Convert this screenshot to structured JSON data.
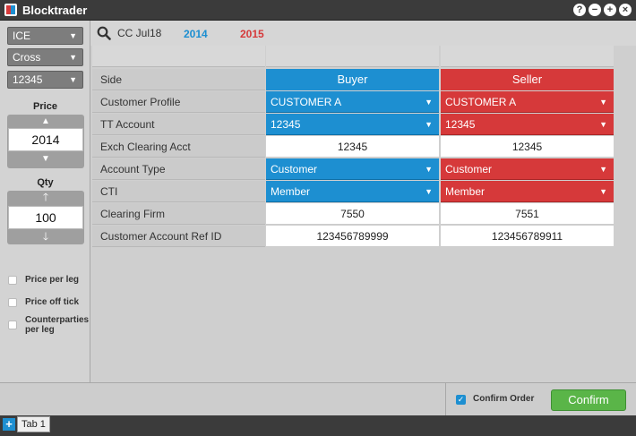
{
  "app": {
    "title": "Blocktrader"
  },
  "window_controls": [
    "help-icon",
    "minimize-icon",
    "add-icon",
    "close-icon"
  ],
  "left_panel": {
    "dropdowns": [
      {
        "value": "ICE"
      },
      {
        "value": "Cross"
      },
      {
        "value": "12345"
      }
    ],
    "price": {
      "label": "Price",
      "value": "2014"
    },
    "qty": {
      "label": "Qty",
      "value": "100"
    },
    "options": [
      {
        "label": "Price per leg",
        "checked": false
      },
      {
        "label": "Price off tick",
        "checked": false
      },
      {
        "label": "Counterparties per leg",
        "checked": false
      }
    ]
  },
  "header": {
    "contract": "CC Jul18",
    "year1": "2014",
    "year2": "2015"
  },
  "grid": {
    "rows": [
      {
        "label": "Side",
        "buyer": "Buyer",
        "seller": "Seller",
        "kind": "header"
      },
      {
        "label": "Customer Profile",
        "buyer": "CUSTOMER A",
        "seller": "CUSTOMER A",
        "kind": "select"
      },
      {
        "label": "TT Account",
        "buyer": "12345",
        "seller": "12345",
        "kind": "select"
      },
      {
        "label": "Exch Clearing Acct",
        "buyer": "12345",
        "seller": "12345",
        "kind": "text"
      },
      {
        "label": "Account Type",
        "buyer": "Customer",
        "seller": "Customer",
        "kind": "select"
      },
      {
        "label": "CTI",
        "buyer": "Member",
        "seller": "Member",
        "kind": "select"
      },
      {
        "label": "Clearing Firm",
        "buyer": "7550",
        "seller": "7551",
        "kind": "text"
      },
      {
        "label": "Customer Account Ref ID",
        "buyer": "123456789999",
        "seller": "123456789911",
        "kind": "text"
      }
    ]
  },
  "footer": {
    "confirm_order_label": "Confirm Order",
    "confirm_order_checked": true,
    "confirm_button": "Confirm"
  },
  "tabs": [
    {
      "label": "Tab 1"
    }
  ],
  "colors": {
    "buyer": "#1d8fd1",
    "seller": "#d6393a",
    "confirm": "#5ab548"
  }
}
